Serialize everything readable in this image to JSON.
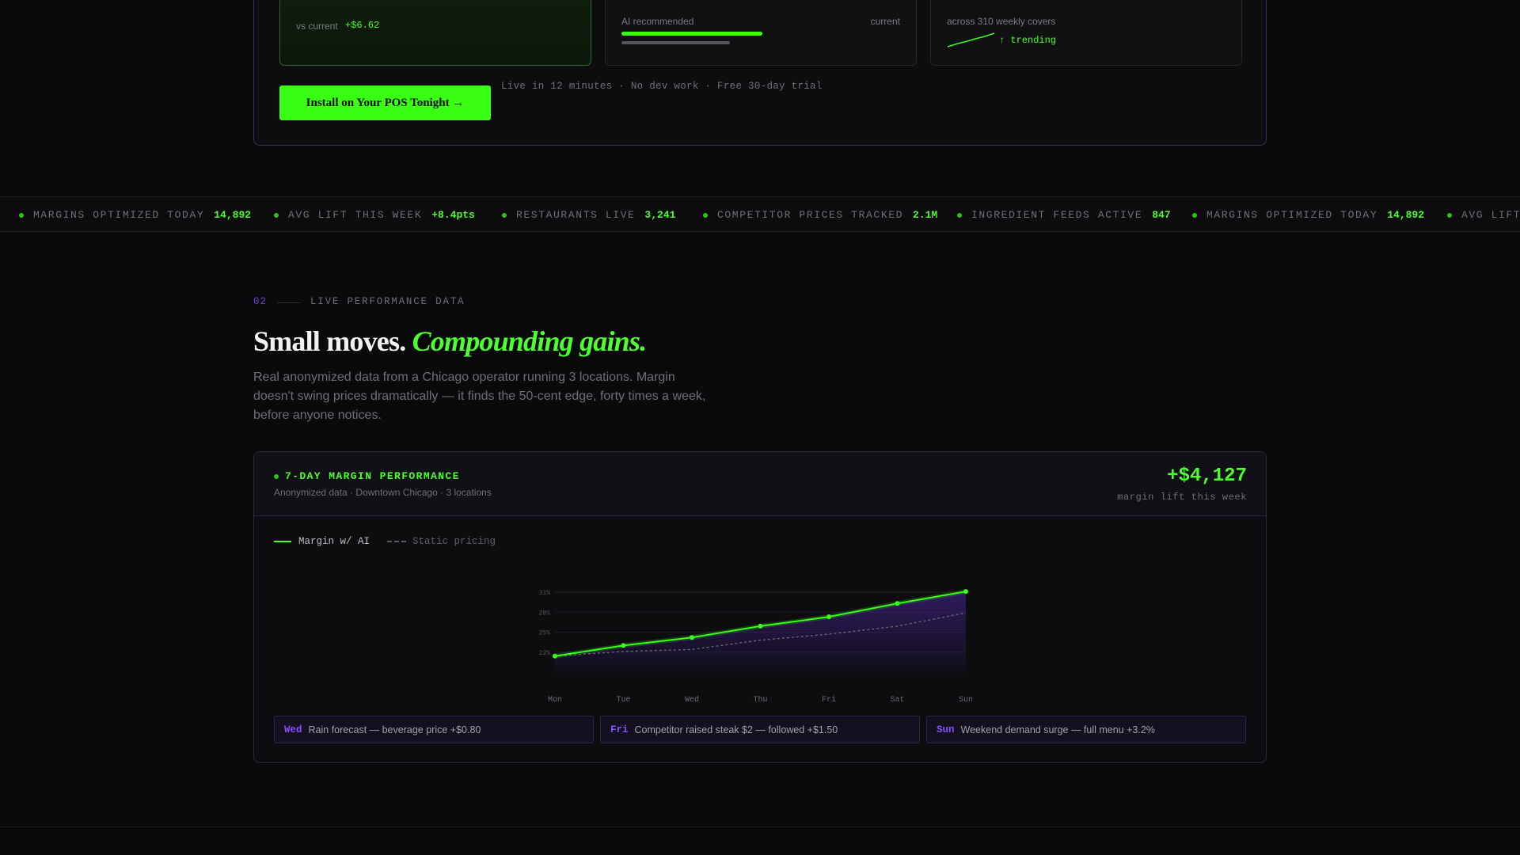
{
  "hero": {
    "box1": {
      "vs_label": "vs current",
      "vs_value": "+$6.62"
    },
    "box2": {
      "left_label": "AI recommended",
      "right_label": "current",
      "ai_share": 0.87,
      "current_share": 0.67
    },
    "box3": {
      "caption": "across 310 weekly covers",
      "trend_label": "↑ trending"
    },
    "cta_label": "Install on Your POS Tonight →",
    "cta_note": "Live in 12 minutes · No dev work · Free 30-day trial"
  },
  "ticker": [
    {
      "label": "MARGINS OPTIMIZED TODAY",
      "value": "14,892"
    },
    {
      "label": "AVG LIFT THIS WEEK",
      "value": "+8.4pts"
    },
    {
      "label": "RESTAURANTS LIVE",
      "value": "3,241"
    },
    {
      "label": "COMPETITOR PRICES TRACKED",
      "value": "2.1M"
    },
    {
      "label": "INGREDIENT FEEDS ACTIVE",
      "value": "847"
    },
    {
      "label": "MARGINS OPTIMIZED TODAY",
      "value": "14,892"
    },
    {
      "label": "AVG LIFT",
      "value": ""
    }
  ],
  "section": {
    "number": "02",
    "label": "LIVE PERFORMANCE DATA",
    "headline_plain": "Small moves.",
    "headline_accent": "Compounding gains.",
    "lede": "Real anonymized data from a Chicago operator running 3 locations. Margin doesn't swing prices dramatically — it finds the 50-cent edge, forty times a week, before anyone notices."
  },
  "performance": {
    "title": "7-DAY MARGIN PERFORMANCE",
    "subtitle": "Anonymized data · Downtown Chicago · 3 locations",
    "big_value": "+$4,127",
    "big_caption": "margin lift this week",
    "legend_ai": "Margin w/ AI",
    "legend_static": "Static pricing",
    "notes": [
      {
        "day": "Wed",
        "text": "Rain forecast — beverage price +$0.80"
      },
      {
        "day": "Fri",
        "text": "Competitor raised steak $2 — followed +$1.50"
      },
      {
        "day": "Sun",
        "text": "Weekend demand surge — full menu +3.2%"
      }
    ]
  },
  "chart_data": {
    "type": "line",
    "categories": [
      "Mon",
      "Tue",
      "Wed",
      "Thu",
      "Fri",
      "Sat",
      "Sun"
    ],
    "y_ticks": [
      "22%",
      "25%",
      "28%",
      "31%"
    ],
    "ylim": [
      19,
      31
    ],
    "series": [
      {
        "name": "Margin w/ AI",
        "values": [
          21.4,
          23.0,
          24.2,
          25.9,
          27.3,
          29.3,
          31.1
        ],
        "color": "#39ff14"
      },
      {
        "name": "Static pricing",
        "values": [
          21.4,
          22.1,
          22.4,
          23.8,
          24.7,
          25.9,
          27.9
        ],
        "color": "#6a6a72"
      }
    ],
    "area_fill": "#3b1f7a"
  }
}
